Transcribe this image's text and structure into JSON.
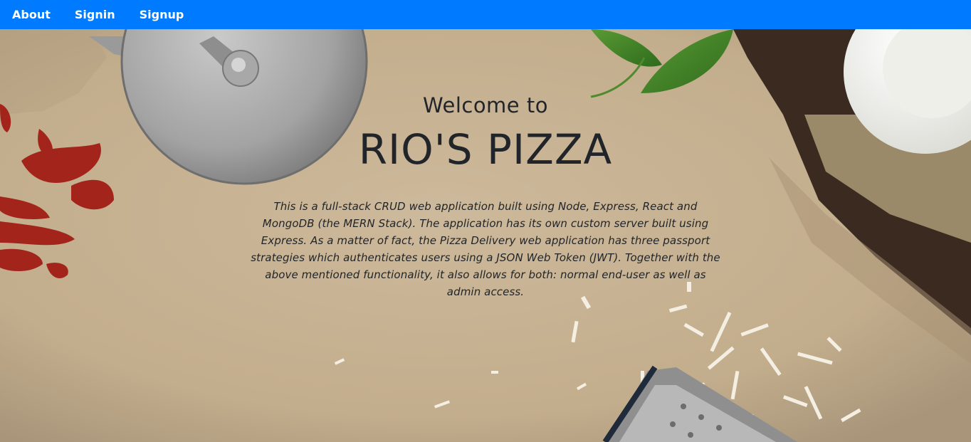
{
  "nav": {
    "items": [
      {
        "label": "About"
      },
      {
        "label": "Signin"
      },
      {
        "label": "Signup"
      }
    ]
  },
  "hero": {
    "welcome": "Welcome to",
    "title": "RIO'S PIZZA",
    "description": "This is a full-stack CRUD web application built using Node, Express, React and MongoDB (the MERN Stack). The application has its own custom server built using Express. As a matter of fact, the Pizza Delivery web application has three passport strategies which authenticates users using a JSON Web Token (JWT). Together with the above mentioned functionality, it also allows for both: normal end-user as well as admin access."
  },
  "colors": {
    "navbar": "#007bff",
    "text": "#212529",
    "parchment": "#c9b596"
  }
}
